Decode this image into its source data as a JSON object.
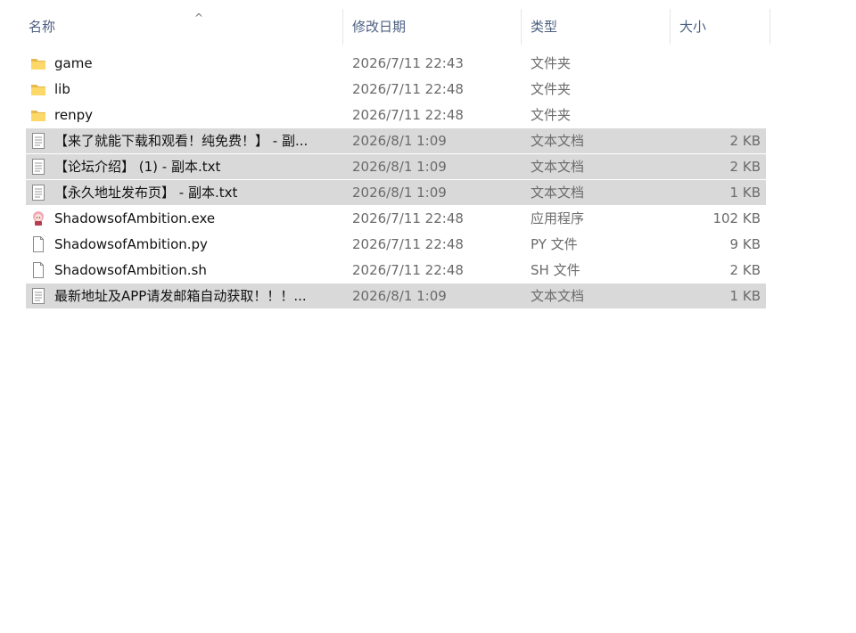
{
  "columns": {
    "name": "名称",
    "date": "修改日期",
    "type": "类型",
    "size": "大小"
  },
  "sort_indicator": "^",
  "files": [
    {
      "name": "game",
      "date": "2026/7/11 22:43",
      "type": "文件夹",
      "size": "",
      "icon": "folder-icon",
      "selected": false
    },
    {
      "name": "lib",
      "date": "2026/7/11 22:48",
      "type": "文件夹",
      "size": "",
      "icon": "folder-icon",
      "selected": false
    },
    {
      "name": "renpy",
      "date": "2026/7/11 22:48",
      "type": "文件夹",
      "size": "",
      "icon": "folder-icon",
      "selected": false
    },
    {
      "name": "【来了就能下载和观看！纯免费！】 - 副...",
      "date": "2026/8/1 1:09",
      "type": "文本文档",
      "size": "2 KB",
      "icon": "text-document-icon",
      "selected": true
    },
    {
      "name": "【论坛介绍】 (1) - 副本.txt",
      "date": "2026/8/1 1:09",
      "type": "文本文档",
      "size": "2 KB",
      "icon": "text-document-icon",
      "selected": true
    },
    {
      "name": "【永久地址发布页】 - 副本.txt",
      "date": "2026/8/1 1:09",
      "type": "文本文档",
      "size": "1 KB",
      "icon": "text-document-icon",
      "selected": true
    },
    {
      "name": "ShadowsofAmbition.exe",
      "date": "2026/7/11 22:48",
      "type": "应用程序",
      "size": "102 KB",
      "icon": "application-icon",
      "selected": false
    },
    {
      "name": "ShadowsofAmbition.py",
      "date": "2026/7/11 22:48",
      "type": "PY 文件",
      "size": "9 KB",
      "icon": "blank-file-icon",
      "selected": false
    },
    {
      "name": "ShadowsofAmbition.sh",
      "date": "2026/7/11 22:48",
      "type": "SH 文件",
      "size": "2 KB",
      "icon": "blank-file-icon",
      "selected": false
    },
    {
      "name": "最新地址及APP请发邮箱自动获取！！！...",
      "date": "2026/8/1 1:09",
      "type": "文本文档",
      "size": "1 KB",
      "icon": "text-document-icon",
      "selected": true
    }
  ]
}
